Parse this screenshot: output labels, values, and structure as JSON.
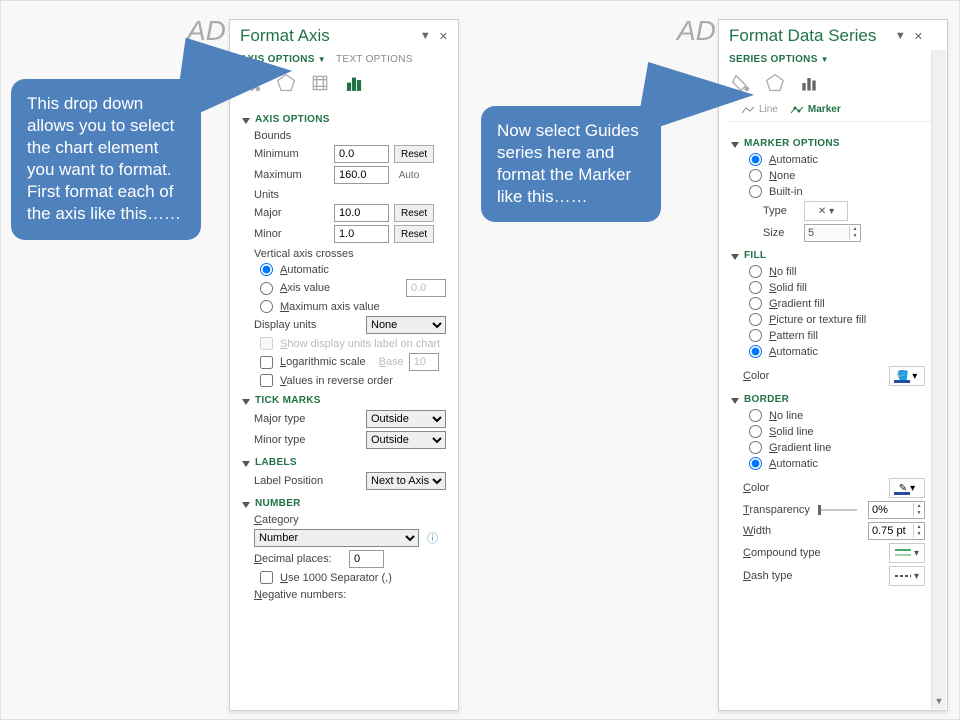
{
  "left_panel": {
    "title": "Format Axis",
    "tabs": {
      "axis_options": "Axis Options",
      "text_options": "Text Options"
    },
    "sections": {
      "axis_options": "Axis Options",
      "bounds": "Bounds",
      "min_label": "Minimum",
      "min_val": "0.0",
      "max_label": "Maximum",
      "max_val": "160.0",
      "reset": "Reset",
      "auto": "Auto",
      "units": "Units",
      "major_label": "Major",
      "major_val": "10.0",
      "minor_label": "Minor",
      "minor_val": "1.0",
      "vac": "Vertical axis crosses",
      "auto_r": "Automatic",
      "axis_value_r": "Axis value",
      "axis_value_v": "0.0",
      "max_axis_r": "Maximum axis value",
      "display_units": "Display units",
      "display_units_v": "None",
      "show_units_chk": "Show display units label on chart",
      "log_chk": "Logarithmic scale",
      "base_label": "Base",
      "base_val": "10",
      "reverse_chk": "Values in reverse order",
      "tick_marks": "Tick Marks",
      "major_type": "Major type",
      "major_type_v": "Outside",
      "minor_type": "Minor type",
      "minor_type_v": "Outside",
      "labels": "Labels",
      "label_pos": "Label Position",
      "label_pos_v": "Next to Axis",
      "number": "Number",
      "category": "Category",
      "category_v": "Number",
      "decimal": "Decimal places:",
      "decimal_v": "0",
      "thousand": "Use 1000 Separator (,)",
      "negative": "Negative numbers:"
    }
  },
  "right_panel": {
    "title": "Format Data Series",
    "tab": "Series Options",
    "subtabs": {
      "line": "Line",
      "marker": "Marker"
    },
    "sections": {
      "marker_options": "Marker Options",
      "auto_r": "Automatic",
      "none_r": "None",
      "builtin_r": "Built-in",
      "type_lbl": "Type",
      "size_lbl": "Size",
      "size_v": "5",
      "fill": "Fill",
      "no_fill": "No fill",
      "solid_fill": "Solid fill",
      "grad_fill": "Gradient fill",
      "pic_fill": "Picture or texture fill",
      "pat_fill": "Pattern fill",
      "auto_fill": "Automatic",
      "color": "Color",
      "border": "Border",
      "no_line": "No line",
      "solid_line": "Solid line",
      "grad_line": "Gradient line",
      "auto_line": "Automatic",
      "transparency": "Transparency",
      "transparency_v": "0%",
      "width": "Width",
      "width_v": "0.75 pt",
      "compound": "Compound type",
      "dash": "Dash type"
    }
  },
  "callouts": {
    "left": "This drop down allows you to select the chart element you want to format.\nFirst format each of the axis like this……",
    "right": "Now select Guides series here and format the Marker like this……"
  },
  "edge_glyph": "AD"
}
